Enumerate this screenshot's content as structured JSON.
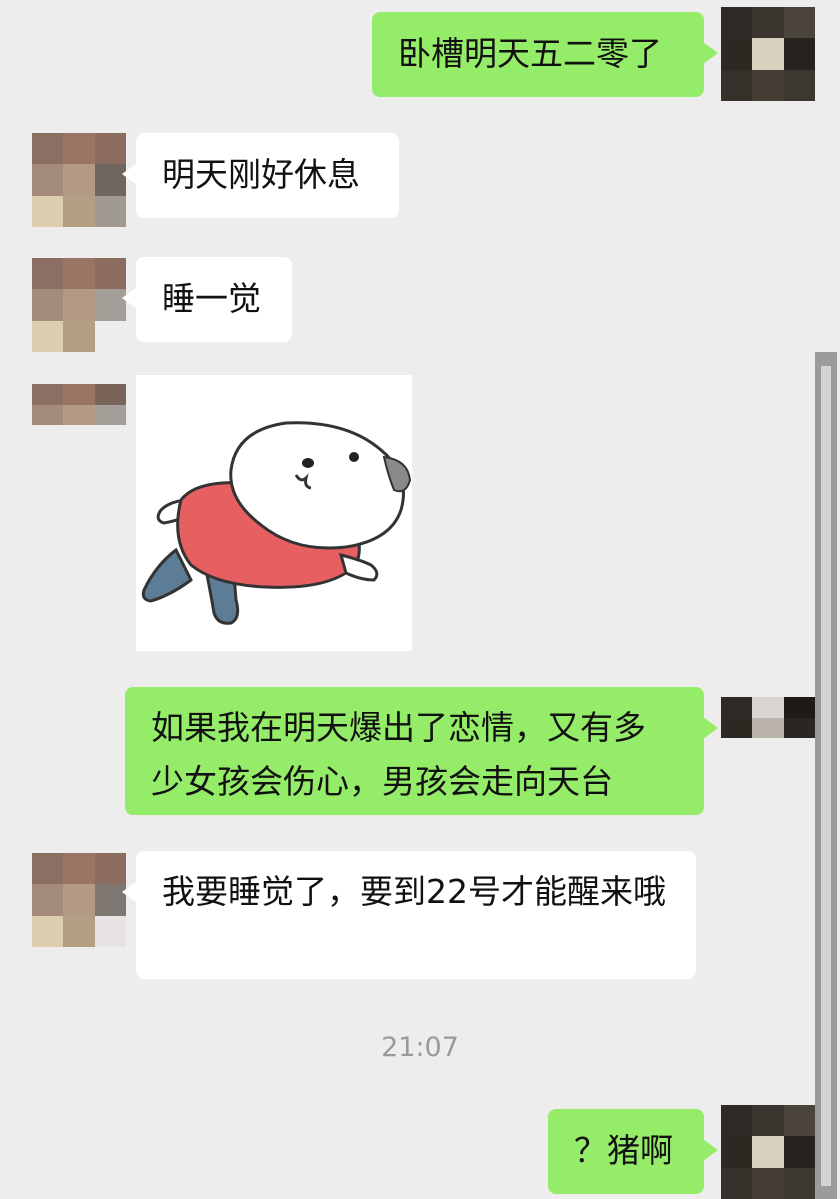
{
  "chat": {
    "messages": [
      {
        "id": "m1",
        "side": "right",
        "text": "卧槽明天五二零了"
      },
      {
        "id": "m2",
        "side": "left",
        "text": "明天刚好休息"
      },
      {
        "id": "m3",
        "side": "left",
        "text": "睡一觉"
      },
      {
        "id": "m4",
        "side": "left",
        "type": "sticker",
        "sticker_icon": "sleeping-cartoon-sticker-icon"
      },
      {
        "id": "m5",
        "side": "right",
        "text": "如果我在明天爆出了恋情，又有多少女孩会伤心，男孩会走向天台"
      },
      {
        "id": "m6",
        "side": "left",
        "text": "我要睡觉了，要到22号才能醒来哦"
      },
      {
        "id": "m7",
        "side": "right",
        "text": "？猪啊"
      }
    ],
    "timestamp": "21:07"
  },
  "colors": {
    "background": "#ededed",
    "my_bubble": "#95ec69",
    "their_bubble": "#ffffff",
    "timestamp_text": "#9a9a9a"
  },
  "avatars": {
    "me_icon": "pixelated-avatar-icon",
    "them_icon": "pixelated-avatar-icon"
  }
}
